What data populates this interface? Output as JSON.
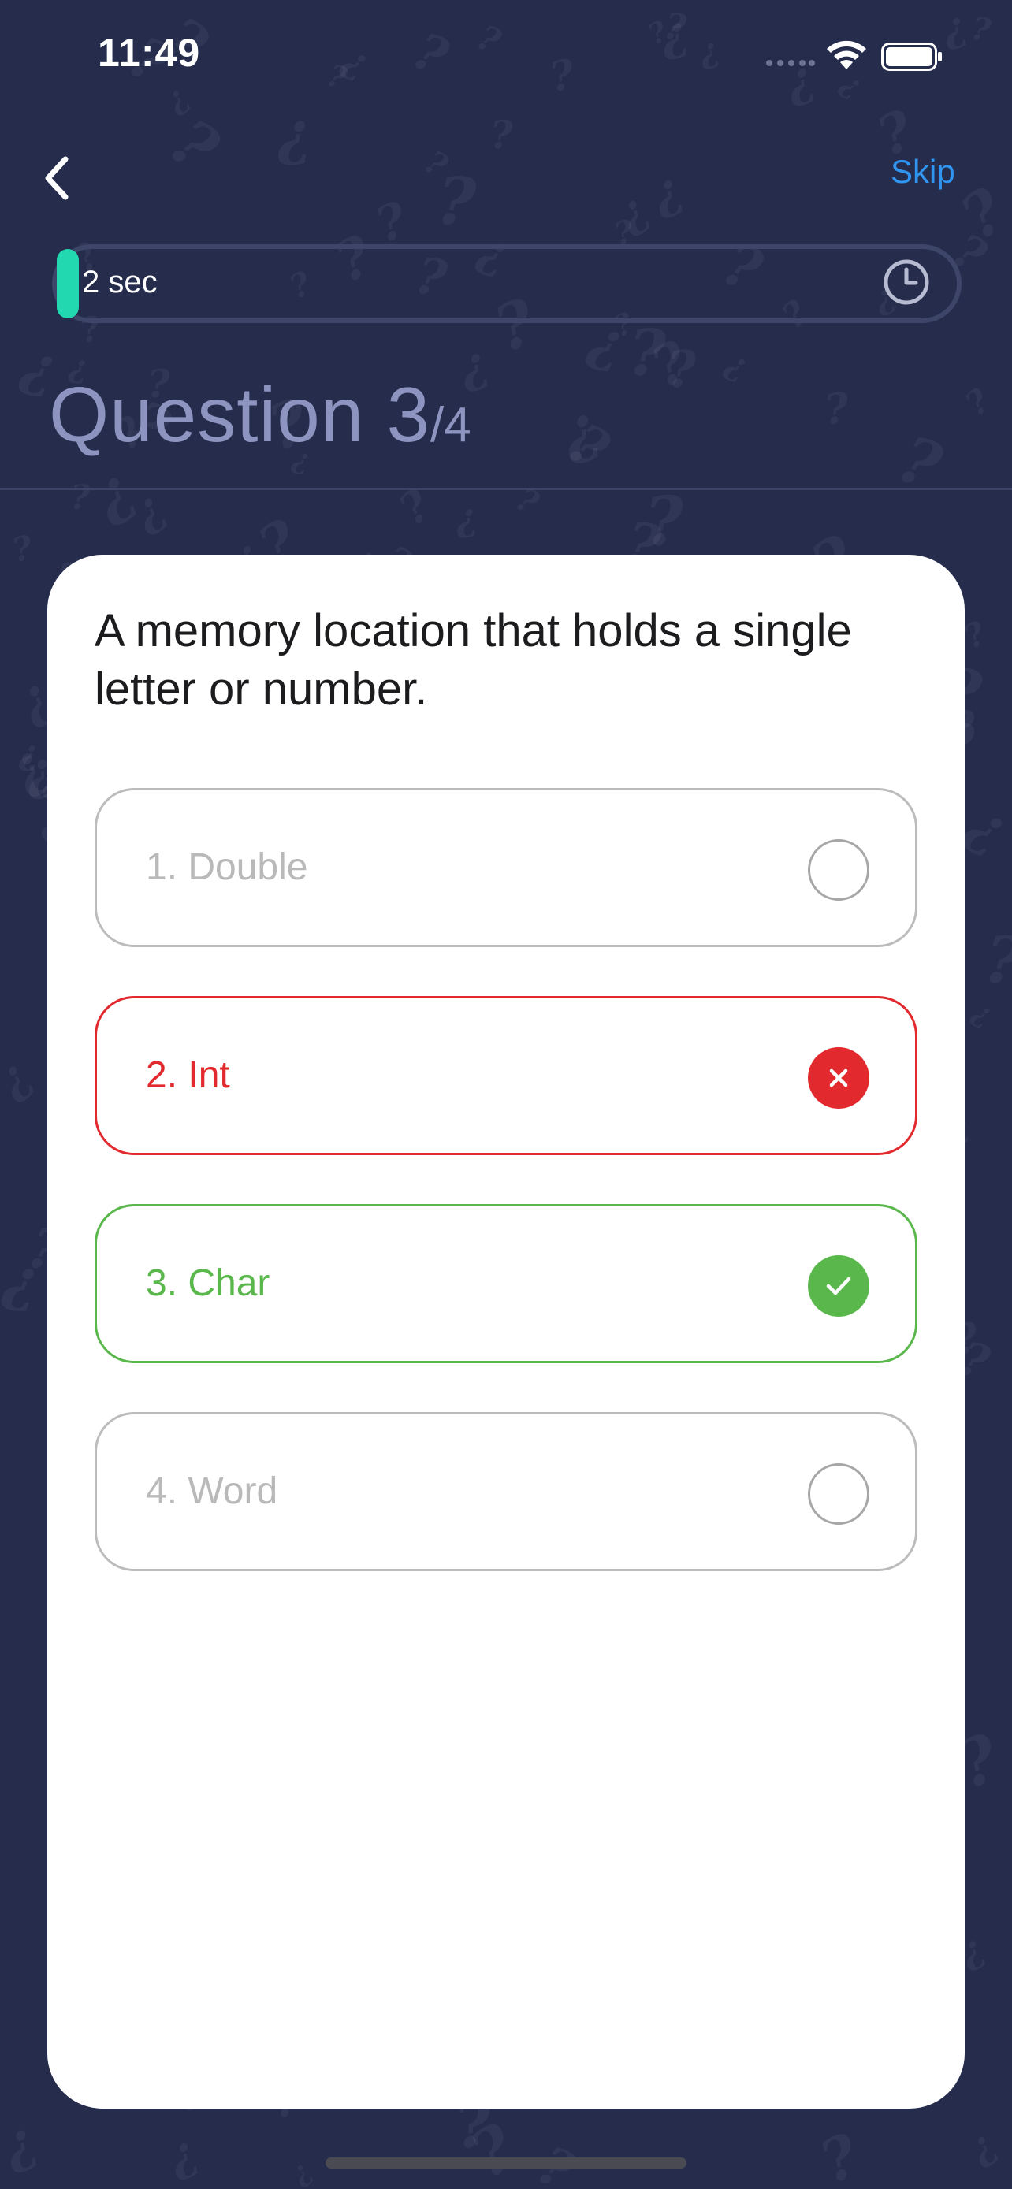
{
  "status_bar": {
    "time": "11:49"
  },
  "nav": {
    "back_icon": "chevron-left-icon",
    "skip_label": "Skip"
  },
  "timer": {
    "text": "2 sec",
    "icon": "clock-icon",
    "progress_fraction": 0.02,
    "fill_color": "#22d8b0"
  },
  "question": {
    "heading": "Question 3",
    "total": "/4",
    "text": "A memory location that holds a single letter or number."
  },
  "options": [
    {
      "label": "1. Double",
      "state": "neutral"
    },
    {
      "label": "2. Int",
      "state": "wrong",
      "icon": "close-icon"
    },
    {
      "label": "3. Char",
      "state": "correct",
      "icon": "check-icon"
    },
    {
      "label": "4. Word",
      "state": "neutral"
    }
  ],
  "colors": {
    "background": "#252c4c",
    "skip": "#2f95f0",
    "wrong": "#e2292e",
    "correct": "#5ab74c",
    "heading": "#8d94c0"
  }
}
